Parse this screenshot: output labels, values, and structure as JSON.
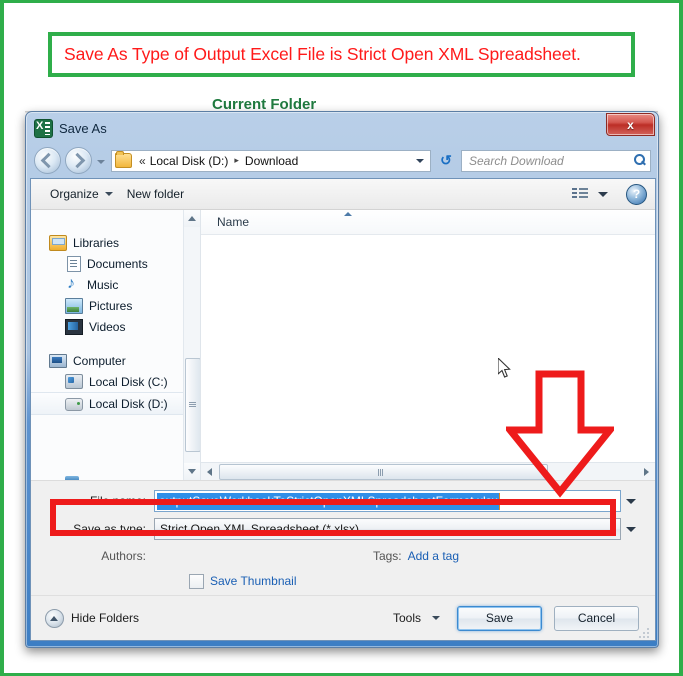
{
  "caption": {
    "text": "Save As Type of Output Excel File is Strict Open XML Spreadsheet.",
    "text_color": "#ff1a1a",
    "border_color": "#2fae4a"
  },
  "background": {
    "current_folder_label": "Current Folder"
  },
  "dialog": {
    "title": "Save As",
    "app_icon": "excel-icon",
    "close_label": "x",
    "address": {
      "back_icon": "back-arrow-icon",
      "forward_icon": "forward-arrow-icon",
      "history_icon": "chevron-down-icon",
      "folder_icon": "folder-icon",
      "overflow": "«",
      "crumbs": [
        "Local Disk (D:)",
        "Download"
      ],
      "separator": "▸",
      "dropdown_icon": "chevron-down-icon",
      "refresh_icon": "refresh-icon",
      "refresh_glyph": "↺"
    },
    "search": {
      "placeholder": "Search Download",
      "value": "",
      "icon": "search-icon"
    },
    "commandbar": {
      "organize": "Organize",
      "new_folder": "New folder",
      "view_icon": "view-list-icon",
      "help_icon": "help-icon",
      "help_glyph": "?"
    },
    "navpane": {
      "items": [
        {
          "label": "Libraries",
          "icon": "libraries-icon",
          "level": 0,
          "selected": false
        },
        {
          "label": "Documents",
          "icon": "documents-icon",
          "level": 1,
          "selected": false
        },
        {
          "label": "Music",
          "icon": "music-icon",
          "level": 1,
          "selected": false
        },
        {
          "label": "Pictures",
          "icon": "pictures-icon",
          "level": 1,
          "selected": false
        },
        {
          "label": "Videos",
          "icon": "videos-icon",
          "level": 1,
          "selected": false
        },
        {
          "label": "Computer",
          "icon": "computer-icon",
          "level": 0,
          "selected": false
        },
        {
          "label": "Local Disk (C:)",
          "icon": "hard-disk-icon",
          "level": 1,
          "selected": false
        },
        {
          "label": "Local Disk (D:)",
          "icon": "hard-disk-icon",
          "level": 1,
          "selected": true
        }
      ]
    },
    "filelist": {
      "column_header": "Name",
      "rows": [],
      "sort_indicator": "sort-ascending-icon"
    },
    "form": {
      "filename_label": "File name:",
      "filename_value": "outputSaveWorkbookToStrictOpenXMLSpreadsheetFormat.xlsx",
      "savetype_label": "Save as type:",
      "savetype_value": "Strict Open XML Spreadsheet (*.xlsx)",
      "authors_label": "Authors:",
      "authors_value": "",
      "tags_label": "Tags:",
      "tags_link": "Add a tag",
      "save_thumbnail_label": "Save Thumbnail",
      "save_thumbnail_checked": false
    },
    "footer": {
      "hide_folders": "Hide Folders",
      "tools": "Tools",
      "save": "Save",
      "cancel": "Cancel"
    }
  },
  "annotations": {
    "arrow": {
      "name": "red-down-arrow",
      "color": "#ee1b1b"
    },
    "highlight_rect": {
      "name": "red-highlight-rectangle",
      "color": "#ee1b1b"
    },
    "cursor": {
      "name": "mouse-cursor"
    }
  }
}
